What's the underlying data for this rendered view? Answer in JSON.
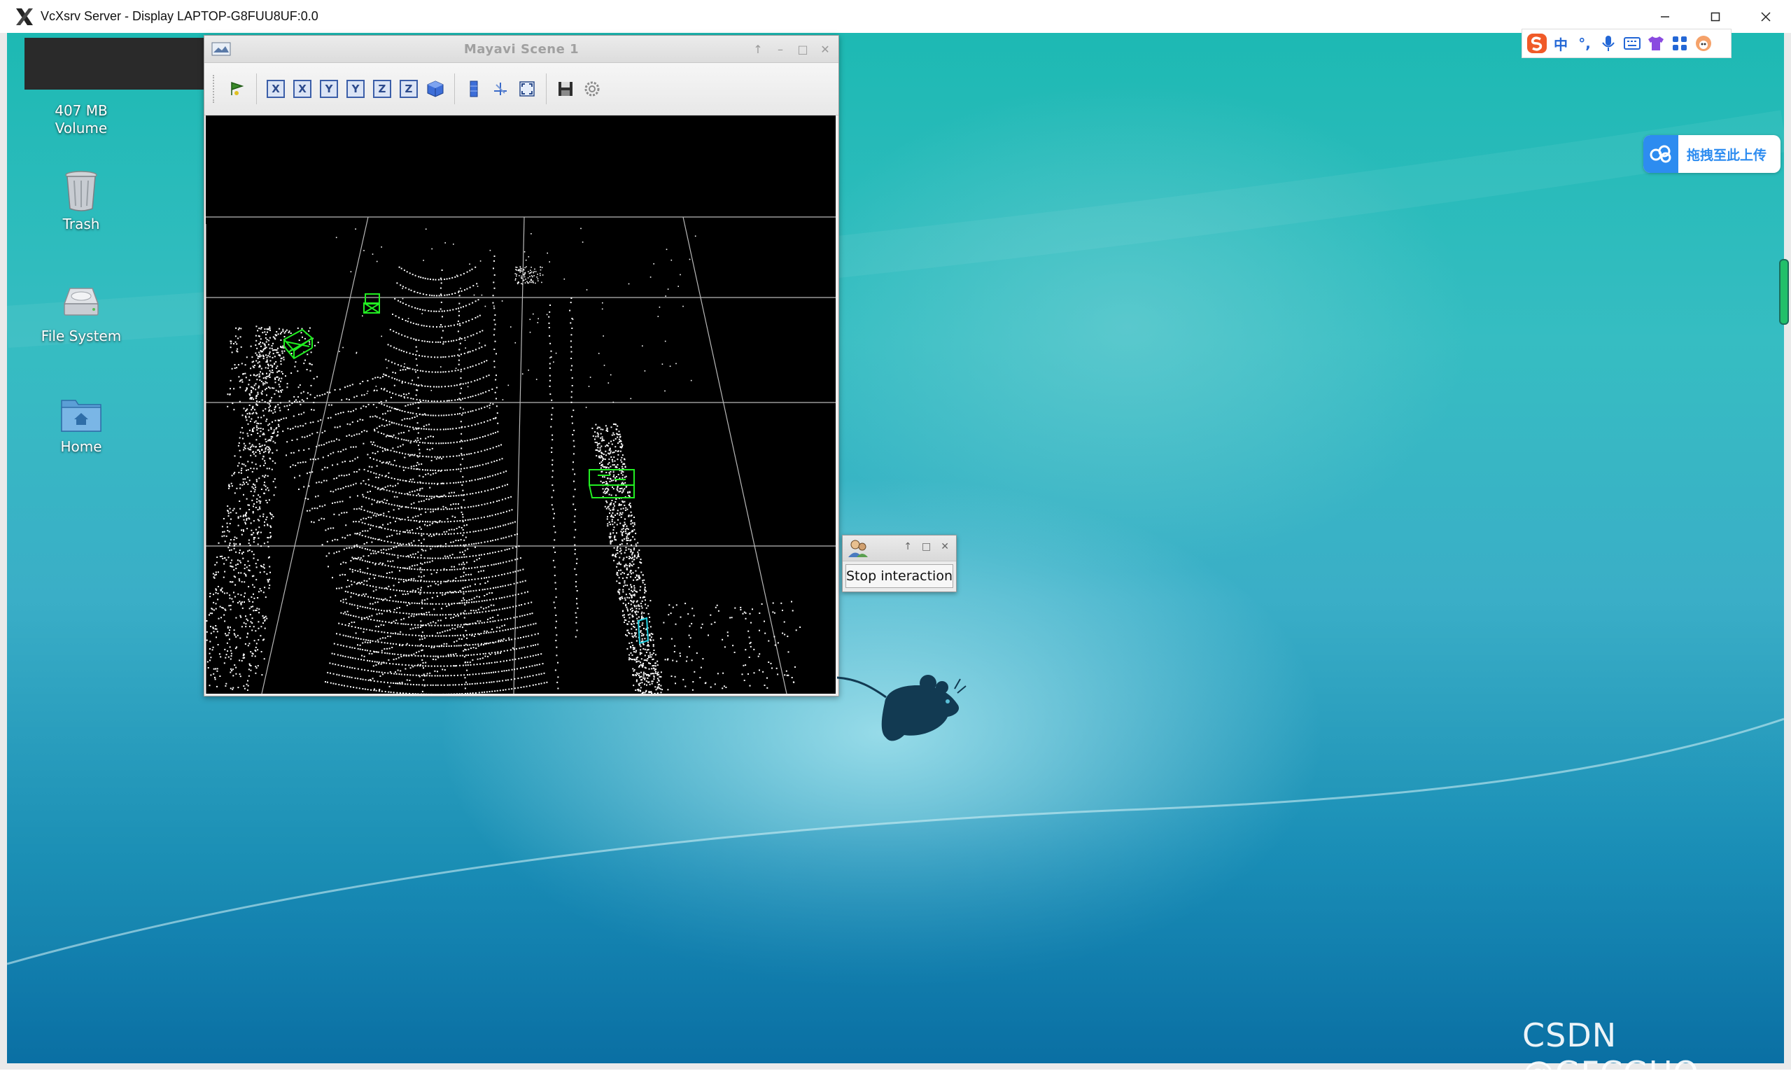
{
  "window": {
    "title": "VcXsrv Server - Display LAPTOP-G8FUU8UF:0.0",
    "controls": [
      "minimize",
      "maximize",
      "close"
    ]
  },
  "desktop": {
    "icons": [
      {
        "label": "407 MB\nVolume",
        "icon": "drive-icon"
      },
      {
        "label": "Trash",
        "icon": "trash-icon"
      },
      {
        "label": "File System",
        "icon": "filesystem-icon"
      },
      {
        "label": "Home",
        "icon": "home-folder-icon"
      }
    ]
  },
  "mayavi": {
    "title": "Mayavi Scene 1",
    "toolbar": [
      {
        "name": "pipeline-icon"
      },
      {
        "name": "view-x-pos",
        "label": "X"
      },
      {
        "name": "view-x-neg",
        "label": "X"
      },
      {
        "name": "view-y-pos",
        "label": "Y"
      },
      {
        "name": "view-y-neg",
        "label": "Y"
      },
      {
        "name": "view-z-pos",
        "label": "Z"
      },
      {
        "name": "view-z-neg",
        "label": "Z"
      },
      {
        "name": "isometric-view-icon"
      },
      {
        "name": "parallel-projection-icon"
      },
      {
        "name": "axes-icon"
      },
      {
        "name": "fullscreen-icon"
      },
      {
        "name": "save-icon"
      },
      {
        "name": "settings-icon"
      }
    ]
  },
  "popup": {
    "button_label": "Stop interaction"
  },
  "ime": {
    "items": [
      "S",
      "中",
      "°,",
      "mic",
      "keyboard",
      "shirt",
      "grid",
      "avatar"
    ],
    "zh_label": "中",
    "punct_label": "°,"
  },
  "upload": {
    "label": "拖拽至此上传"
  },
  "watermark": "CSDN @GFCGUO",
  "colors": {
    "bbox_green": "#22ee22",
    "bbox_cyan": "#22d0e0",
    "grid": "#b8b8b8",
    "desktop_teal": "#1db9b3",
    "upload_blue": "#2d8cf0"
  }
}
